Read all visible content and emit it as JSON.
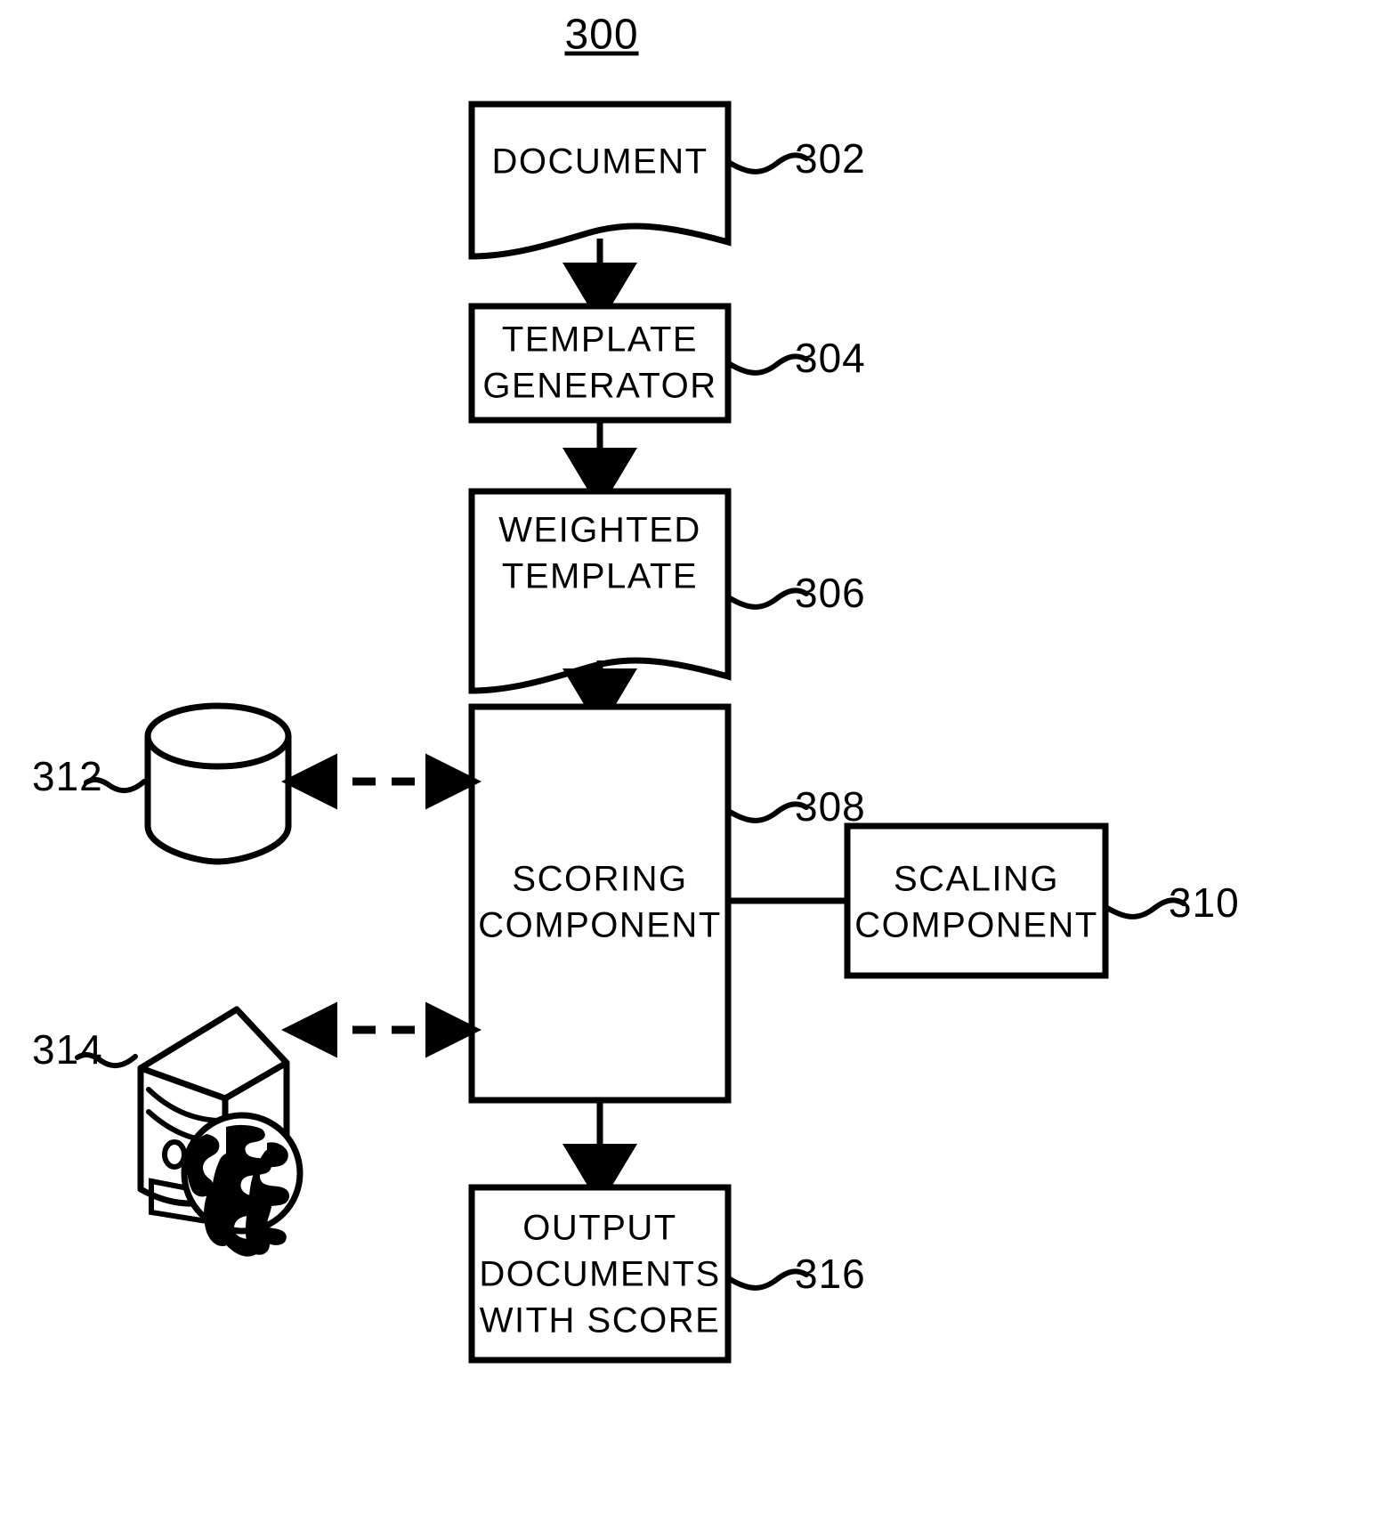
{
  "figure": {
    "number": "300",
    "type": "patent-flow-diagram",
    "background": "#ffffff",
    "ink": "#000000"
  },
  "nodes": {
    "document": {
      "label": "DOCUMENT",
      "ref": "302",
      "shape": "document-wavy-bottom"
    },
    "template_generator": {
      "label_line1": "TEMPLATE",
      "label_line2": "GENERATOR",
      "ref": "304",
      "shape": "rectangle"
    },
    "weighted_template": {
      "label_line1": "WEIGHTED",
      "label_line2": "TEMPLATE",
      "ref": "306",
      "shape": "document-wavy-bottom"
    },
    "scoring_component": {
      "label_line1": "SCORING",
      "label_line2": "COMPONENT",
      "ref": "308",
      "shape": "rectangle"
    },
    "scaling_component": {
      "label_line1": "SCALING",
      "label_line2": "COMPONENT",
      "ref": "310",
      "shape": "rectangle"
    },
    "database": {
      "ref": "312",
      "icon": "database-cylinder-icon",
      "label": ""
    },
    "server": {
      "ref": "314",
      "icon": "server-tower-with-globe-icon",
      "label": ""
    },
    "output_documents": {
      "label_line1": "OUTPUT",
      "label_line2": "DOCUMENTS",
      "label_line3": "WITH  SCORE",
      "ref": "316",
      "shape": "rectangle"
    }
  },
  "connections": [
    {
      "from": "document",
      "to": "template_generator",
      "style": "solid-arrow",
      "direction": "down"
    },
    {
      "from": "template_generator",
      "to": "weighted_template",
      "style": "solid-arrow",
      "direction": "down"
    },
    {
      "from": "weighted_template",
      "to": "scoring_component",
      "style": "solid-arrow",
      "direction": "down"
    },
    {
      "from": "database",
      "to": "scoring_component",
      "style": "dashed-double-arrow",
      "direction": "bidirectional"
    },
    {
      "from": "server",
      "to": "scoring_component",
      "style": "dashed-double-arrow",
      "direction": "bidirectional"
    },
    {
      "from": "scoring_component",
      "to": "scaling_component",
      "style": "solid-line",
      "direction": "none"
    },
    {
      "from": "scoring_component",
      "to": "output_documents",
      "style": "solid-arrow",
      "direction": "down"
    }
  ]
}
